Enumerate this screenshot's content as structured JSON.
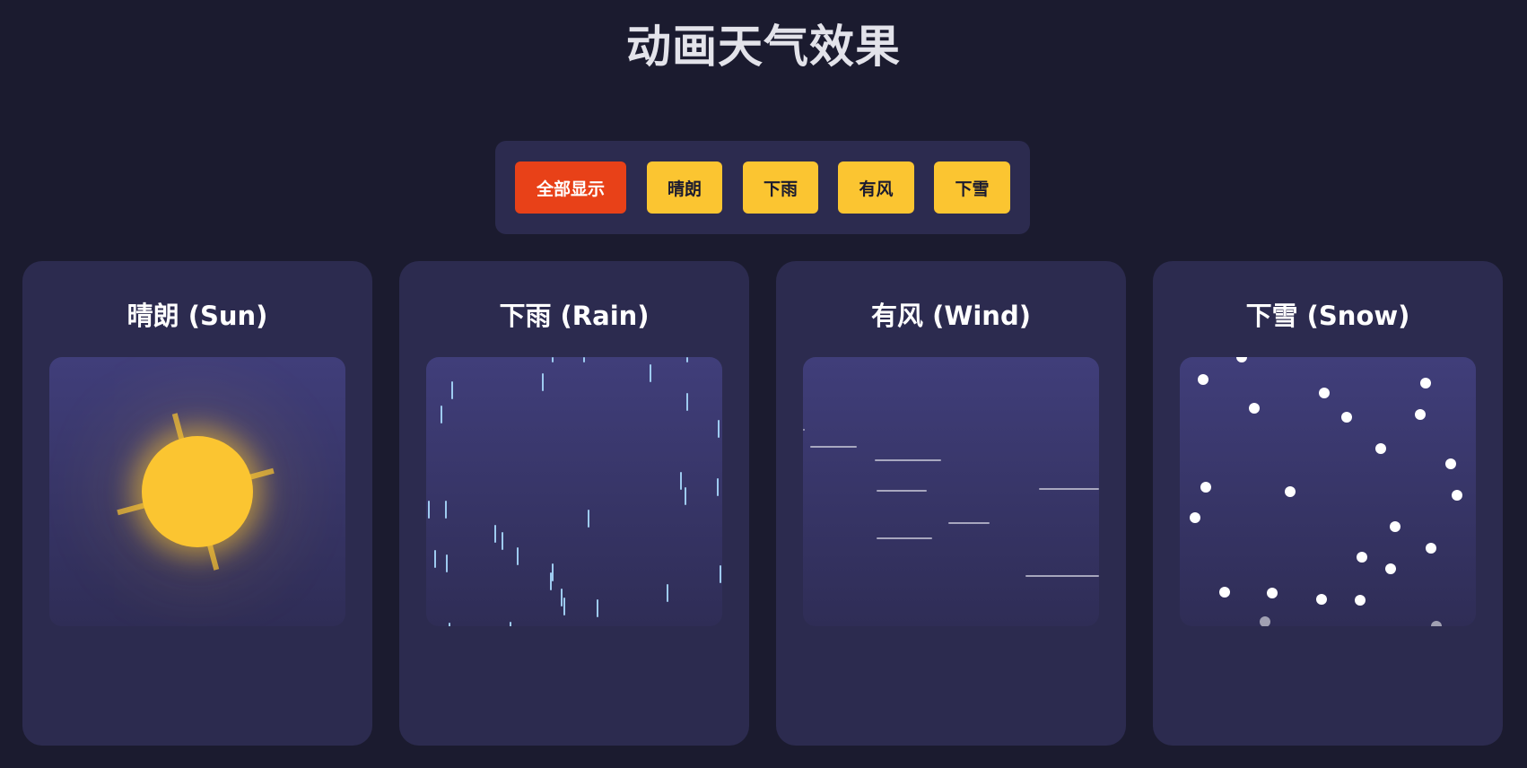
{
  "page": {
    "title": "动画天气效果"
  },
  "filters": [
    {
      "label": "全部显示",
      "active": true
    },
    {
      "label": "晴朗",
      "active": false
    },
    {
      "label": "下雨",
      "active": false
    },
    {
      "label": "有风",
      "active": false
    },
    {
      "label": "下雪",
      "active": false
    }
  ],
  "cards": [
    {
      "title": "晴朗 (Sun)",
      "effect": "sun-icon"
    },
    {
      "title": "下雨 (Rain)",
      "effect": "rain-icon"
    },
    {
      "title": "有风 (Wind)",
      "effect": "wind-icon"
    },
    {
      "title": "下雪 (Snow)",
      "effect": "snow-icon"
    }
  ],
  "colors": {
    "background": "#1b1b2f",
    "panel": "#2c2b4f",
    "button": "#fbc531",
    "button_active": "#e84118",
    "sun": "#fbc531",
    "rain": "#9ecbf0",
    "snow": "#ffffff"
  }
}
